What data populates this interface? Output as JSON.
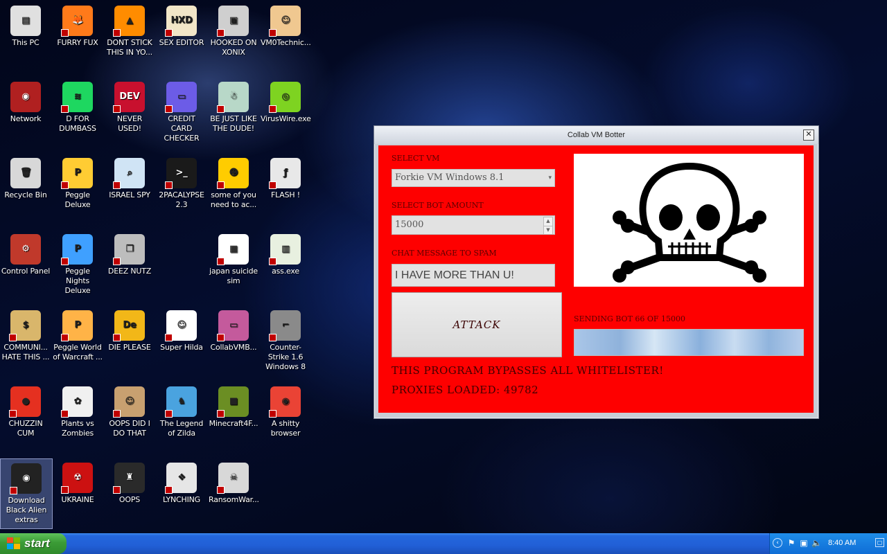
{
  "desktop": {
    "icons": [
      {
        "id": "this-pc",
        "label": "This PC",
        "icon": "computer-icon",
        "color": "#e0e0e0",
        "glyph": "▤"
      },
      {
        "id": "furry-fux",
        "label": "FURRY FUX",
        "icon": "firefox-icon",
        "color": "#ff7a1a",
        "glyph": "🦊"
      },
      {
        "id": "dont-stick",
        "label": "DONT STICK THIS IN YO...",
        "icon": "vlc-cone-icon",
        "color": "#ff8c00",
        "glyph": "▲"
      },
      {
        "id": "sex-editor",
        "label": "SEX EDITOR",
        "icon": "hxd-icon",
        "color": "#f2e6c8",
        "glyph": "HXD"
      },
      {
        "id": "hooked-on-xonix",
        "label": "HOOKED ON XONIX",
        "icon": "xonix-icon",
        "color": "#cfcfcf",
        "glyph": "▣"
      },
      {
        "id": "vm0technic",
        "label": "VM0Technic...",
        "icon": "doctor-icon",
        "color": "#f0c890",
        "glyph": "☺"
      },
      {
        "id": "network",
        "label": "Network",
        "icon": "network-icon",
        "color": "#b02020",
        "glyph": "◉"
      },
      {
        "id": "d-for-dumbass",
        "label": "D FOR DUMBASS",
        "icon": "spotify-icon",
        "color": "#1ed760",
        "glyph": "≋"
      },
      {
        "id": "never-used",
        "label": "NEVER USED!",
        "icon": "devcpp-icon",
        "color": "#c8102e",
        "glyph": "DEV"
      },
      {
        "id": "credit-card",
        "label": "CREDIT CARD CHECKER",
        "icon": "credit-card-icon",
        "color": "#6c5ce7",
        "glyph": "▭"
      },
      {
        "id": "be-just-like",
        "label": "BE JUST LIKE THE DUDE!",
        "icon": "santa-icon",
        "color": "#b8d8c8",
        "glyph": "☃"
      },
      {
        "id": "viruswire",
        "label": "VirusWire.exe",
        "icon": "limewire-icon",
        "color": "#7ed321",
        "glyph": "◎"
      },
      {
        "id": "recycle-bin",
        "label": "Recycle Bin",
        "icon": "recycle-bin-icon",
        "color": "#d8d8d8",
        "glyph": "🗑"
      },
      {
        "id": "peggle-deluxe",
        "label": "Peggle Deluxe",
        "icon": "peggle-icon",
        "color": "#ffcc33",
        "glyph": "P"
      },
      {
        "id": "israel-spy",
        "label": "ISRAEL SPY",
        "icon": "spy-icon",
        "color": "#d0e4f5",
        "glyph": "⌕"
      },
      {
        "id": "2pacalypse",
        "label": "2PACALYPSE 2.3",
        "icon": "terminal-icon",
        "color": "#1a1a1a",
        "glyph": ">_"
      },
      {
        "id": "some-of-you",
        "label": "some of you need to ac...",
        "icon": "beaver-icon",
        "color": "#ffcc00",
        "glyph": "☻"
      },
      {
        "id": "flash",
        "label": "FLASH !",
        "icon": "flash-icon",
        "color": "#e8e8e8",
        "glyph": "ƒ"
      },
      {
        "id": "control-panel",
        "label": "Control Panel",
        "icon": "control-panel-icon",
        "color": "#c0392b",
        "glyph": "⚙"
      },
      {
        "id": "peggle-nights",
        "label": "Peggle Nights Deluxe",
        "icon": "peggle-nights-icon",
        "color": "#3fa0ff",
        "glyph": "P"
      },
      {
        "id": "deez-nutz",
        "label": "DEEZ NUTZ",
        "icon": "windows-stack-icon",
        "color": "#bdbdbd",
        "glyph": "❐"
      },
      {
        "id": "japan-suicide",
        "label": "japan suicide sim",
        "icon": "document-icon",
        "color": "#ffffff",
        "glyph": "▦"
      },
      {
        "id": "ass-exe",
        "label": "ass.exe",
        "icon": "app-window-icon",
        "color": "#e8f0e0",
        "glyph": "▥"
      },
      {
        "id": "communi",
        "label": "COMMUNI... HATE THIS ...",
        "icon": "money-bag-icon",
        "color": "#d9b66b",
        "glyph": "$"
      },
      {
        "id": "peggle-wow",
        "label": "Peggle World of Warcraft ...",
        "icon": "peggle-wow-icon",
        "color": "#ffb347",
        "glyph": "P"
      },
      {
        "id": "die-please",
        "label": "DIE PLEASE",
        "icon": "dreamweaver-icon",
        "color": "#f2b718",
        "glyph": "De"
      },
      {
        "id": "super-hilda",
        "label": "Super Hilda",
        "icon": "pixel-cat-icon",
        "color": "#ffffff",
        "glyph": "☺"
      },
      {
        "id": "collabvmb",
        "label": "CollabVMB...",
        "icon": "monitor-icon",
        "color": "#c45a9c",
        "glyph": "▭"
      },
      {
        "id": "counter-strike",
        "label": "Counter-Strike 1.6 Windows 8",
        "icon": "counter-strike-icon",
        "color": "#8a8a8a",
        "glyph": "⌐"
      },
      {
        "id": "chuzzin",
        "label": "CHUZZIN CUM",
        "icon": "chuzzle-icon",
        "color": "#e53020",
        "glyph": "●"
      },
      {
        "id": "pvz",
        "label": "Plants vs Zombies",
        "icon": "pvz-icon",
        "color": "#f0f0f0",
        "glyph": "✿"
      },
      {
        "id": "oops-did-i",
        "label": "OOPS DID I DO THAT",
        "icon": "portrait-icon",
        "color": "#c8a070",
        "glyph": "☺"
      },
      {
        "id": "legend-zilda",
        "label": "The Legend of Zilda",
        "icon": "zelda-icon",
        "color": "#4aa3df",
        "glyph": "♞"
      },
      {
        "id": "minecraft",
        "label": "Minecraft4F...",
        "icon": "minecraft-icon",
        "color": "#6b8e23",
        "glyph": "■"
      },
      {
        "id": "chrome",
        "label": "A shitty browser",
        "icon": "chrome-icon",
        "color": "#ea4335",
        "glyph": "◉"
      },
      {
        "id": "download-black",
        "label": "Download Black Alien extras",
        "icon": "black-alien-icon",
        "color": "#222222",
        "glyph": "◉"
      },
      {
        "id": "ukraine",
        "label": "UKRAINE",
        "icon": "radiation-icon",
        "color": "#cc1111",
        "glyph": "☢"
      },
      {
        "id": "oops",
        "label": "OOPS",
        "icon": "dark-figure-icon",
        "color": "#2a2a2a",
        "glyph": "♜"
      },
      {
        "id": "lynching",
        "label": "LYNCHING",
        "icon": "lynching-icon",
        "color": "#e6e6e6",
        "glyph": "❖"
      },
      {
        "id": "ransomwar",
        "label": "RansomWar...",
        "icon": "skull-icon",
        "color": "#d8d8d8",
        "glyph": "☠"
      }
    ]
  },
  "window": {
    "title": "Collab VM Botter",
    "close_label": "✕",
    "select_vm_label": "SELECT VM",
    "select_vm_value": "Forkie VM Windows 8.1",
    "bot_amount_label": "SELECT BOT AMOUNT",
    "bot_amount_value": "15000",
    "chat_label": "CHAT MESSAGE TO SPAM",
    "chat_value": "I HAVE MORE THAN U!",
    "attack_label": "ATTACK",
    "status_text": "SENDING BOT 66 OF 15000",
    "progress_fraction": 1.0,
    "bypass_text": "THIS PROGRAM BYPASSES ALL WHITELISTER!",
    "proxies_text": "PROXIES LOADED: 49782",
    "accent_color": "#fe0000"
  },
  "taskbar": {
    "start_label": "start",
    "clock": "8:40 AM"
  }
}
